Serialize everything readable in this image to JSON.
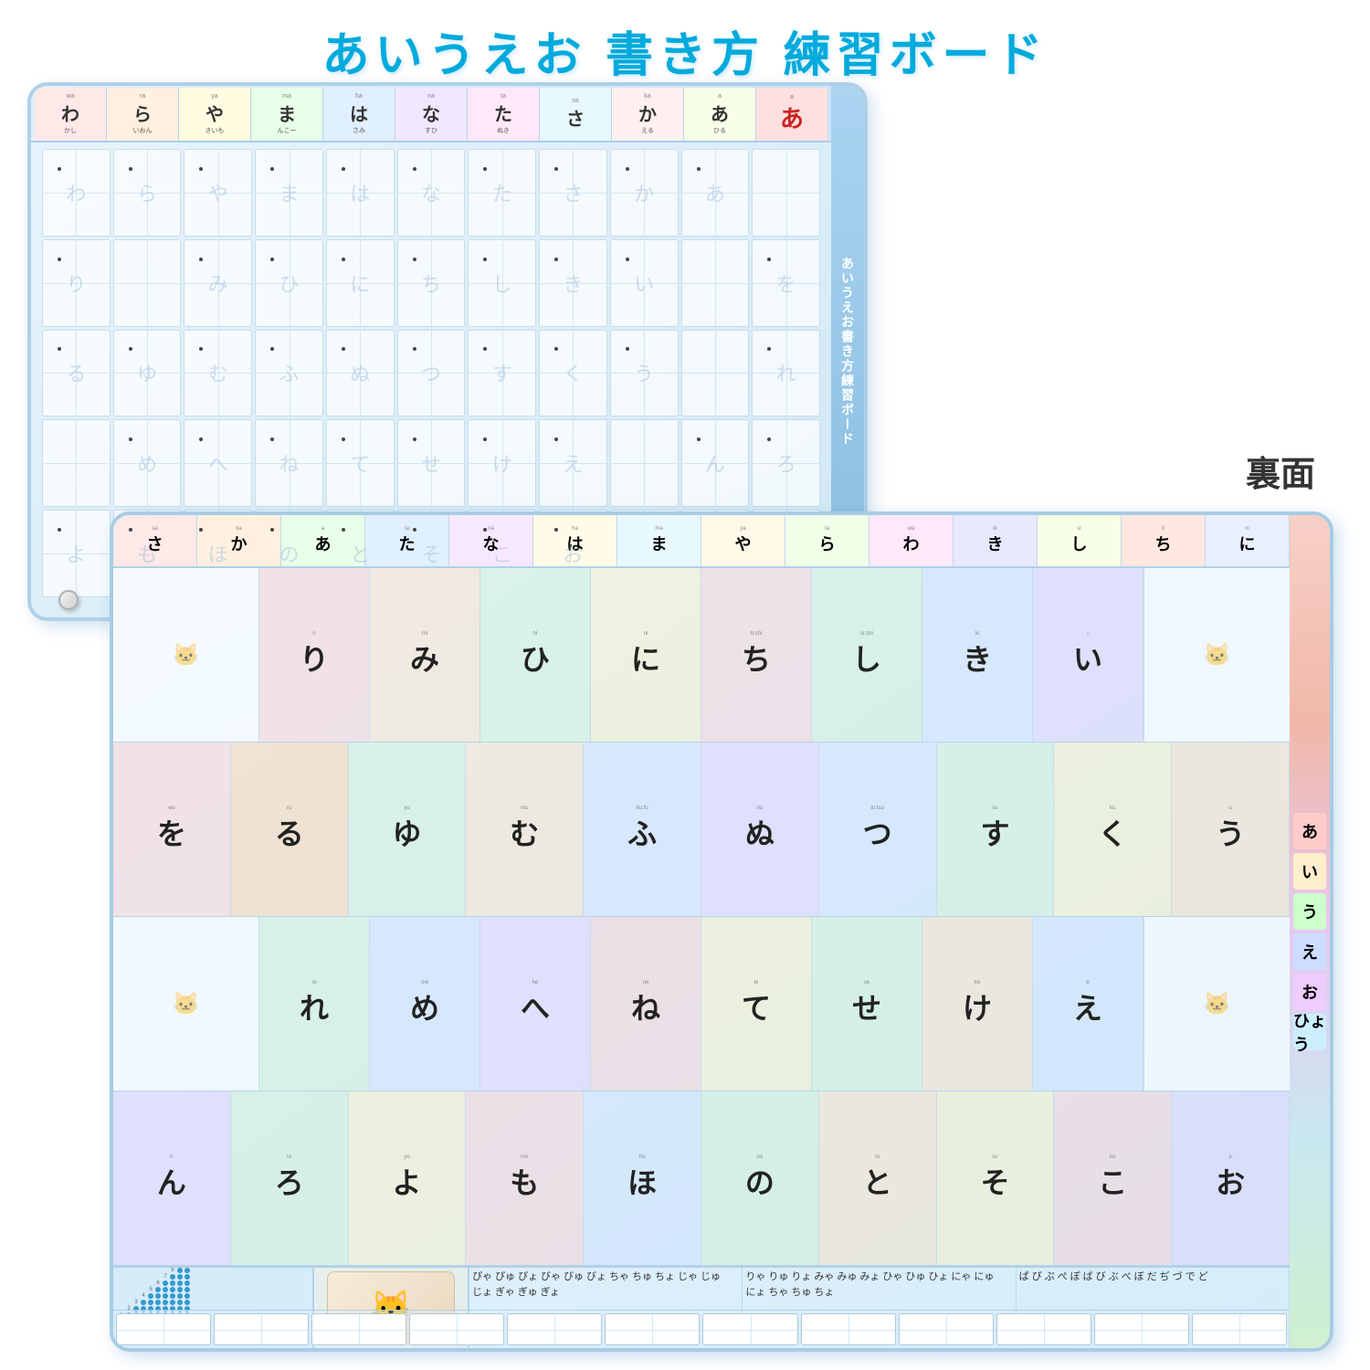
{
  "title": "あいうえお 書き方 練習ボード",
  "ura_label": "裏面",
  "front": {
    "vertical_label": "あいうえお書き方練習ボード",
    "strip": [
      {
        "romaji": "wa",
        "kana": "わ",
        "word": "かし"
      },
      {
        "romaji": "ra",
        "kana": "ら",
        "word": "いおん"
      },
      {
        "romaji": "ya",
        "kana": "や",
        "word": "きいも"
      },
      {
        "romaji": "ma",
        "kana": "ま",
        "word": "んこー"
      },
      {
        "romaji": "ha",
        "kana": "は",
        "word": "さみ"
      },
      {
        "romaji": "na",
        "kana": "な",
        "word": "すひ"
      },
      {
        "romaji": "ta",
        "kana": "た",
        "word": "ぬき"
      },
      {
        "romaji": "sa",
        "kana": "さ",
        "word": ""
      },
      {
        "romaji": "ka",
        "kana": "か",
        "word": "える"
      },
      {
        "romaji": "a",
        "kana": "あ",
        "word": "ひる"
      }
    ],
    "grid_kana": [
      "わ",
      "ら",
      "や",
      "ま",
      "は",
      "な",
      "た",
      "さ",
      "か",
      "あ",
      "",
      "り",
      "",
      "み",
      "ひ",
      "に",
      "ち",
      "し",
      "き",
      "い",
      "",
      "を",
      "る",
      "ゆ",
      "む",
      "ふ",
      "ぬ",
      "つ",
      "す",
      "く",
      "う",
      "",
      "れ",
      "",
      "め",
      "へ",
      "ね",
      "て",
      "せ",
      "け",
      "え",
      "",
      "ん",
      "ろ",
      "よ",
      "も",
      "ほ",
      "の",
      "と",
      "そ",
      "こ",
      "お",
      ""
    ]
  },
  "back": {
    "top_strip": [
      {
        "romaji": "sa",
        "kana": "さ"
      },
      {
        "romaji": "ka",
        "kana": "か"
      },
      {
        "romaji": "a",
        "kana": "あ"
      }
    ],
    "right_labels": [
      "あ",
      "い",
      "う",
      "え",
      "お",
      "ひょう"
    ],
    "rows": [
      {
        "id": "ri-row",
        "cells": [
          {
            "kana": "",
            "type": "blank"
          },
          {
            "kana": "り",
            "romaji": "ri",
            "color": "pink"
          },
          {
            "kana": "",
            "type": "blank"
          },
          {
            "kana": "み",
            "romaji": "mi",
            "color": "peach"
          },
          {
            "kana": "ひ",
            "romaji": "hi",
            "color": "green"
          },
          {
            "kana": "に",
            "romaji": "ni",
            "color": "yellow"
          },
          {
            "kana": "ち",
            "romaji": "ti:chi",
            "color": "pink"
          },
          {
            "kana": "し",
            "romaji": "si:shi",
            "color": "green"
          },
          {
            "kana": "き",
            "romaji": "ki",
            "color": "blue"
          },
          {
            "kana": "い",
            "romaji": "i",
            "color": "purple"
          }
        ]
      },
      {
        "id": "wo-row",
        "cells": [
          {
            "kana": "を",
            "romaji": "wo",
            "color": "pink"
          },
          {
            "kana": "る",
            "romaji": "ru",
            "color": "orange"
          },
          {
            "kana": "ゆ",
            "romaji": "yu",
            "color": "green"
          },
          {
            "kana": "む",
            "romaji": "mu",
            "color": "peach"
          },
          {
            "kana": "ふ",
            "romaji": "hu:fu",
            "color": "blue"
          },
          {
            "kana": "ぬ",
            "romaji": "nu",
            "color": "purple"
          },
          {
            "kana": "つ",
            "romaji": "tu:tsu",
            "color": "blue"
          },
          {
            "kana": "す",
            "romaji": "su",
            "color": "green"
          },
          {
            "kana": "く",
            "romaji": "ku",
            "color": "yellow"
          },
          {
            "kana": "う",
            "romaji": "u",
            "color": "peach"
          }
        ]
      },
      {
        "id": "re-row",
        "cells": [
          {
            "kana": "",
            "type": "blank"
          },
          {
            "kana": "れ",
            "romaji": "re",
            "color": "green"
          },
          {
            "kana": "",
            "type": "blank"
          },
          {
            "kana": "め",
            "romaji": "me",
            "color": "blue"
          },
          {
            "kana": "へ",
            "romaji": "he",
            "color": "purple"
          },
          {
            "kana": "ね",
            "romaji": "ne",
            "color": "pink"
          },
          {
            "kana": "て",
            "romaji": "te",
            "color": "yellow"
          },
          {
            "kana": "せ",
            "romaji": "se",
            "color": "green"
          },
          {
            "kana": "け",
            "romaji": "ke",
            "color": "peach"
          },
          {
            "kana": "え",
            "romaji": "e",
            "color": "blue"
          }
        ]
      },
      {
        "id": "n-row",
        "cells": [
          {
            "kana": "ん",
            "romaji": "n",
            "color": "purple"
          },
          {
            "kana": "ろ",
            "romaji": "ro",
            "color": "green"
          },
          {
            "kana": "よ",
            "romaji": "yo",
            "color": "yellow"
          },
          {
            "kana": "も",
            "romaji": "mo",
            "color": "pink"
          },
          {
            "kana": "ほ",
            "romaji": "ho",
            "color": "blue"
          },
          {
            "kana": "の",
            "romaji": "no",
            "color": "green"
          },
          {
            "kana": "と",
            "romaji": "to",
            "color": "peach"
          },
          {
            "kana": "そ",
            "romaji": "so",
            "color": "yellow"
          },
          {
            "kana": "こ",
            "romaji": "ko",
            "color": "pink"
          },
          {
            "kana": "お",
            "romaji": "o",
            "color": "purple"
          }
        ]
      }
    ],
    "dakuten": {
      "col1": [
        "ぴゃ",
        "ぴゅ",
        "ぴょ",
        "びゃ",
        "びゅ",
        "びょ",
        "ちゃ",
        "ちゅ",
        "ちょ",
        "じゃ",
        "じゅ",
        "じょ",
        "ぎゃ",
        "ぎゅ",
        "ぎょ"
      ],
      "col2": [
        "りゃ",
        "りゅ",
        "りょ",
        "みゃ",
        "みゅ",
        "みょ",
        "ひゃ",
        "ひゅ",
        "ひょ",
        "にゃ",
        "にゅ",
        "にょ",
        "ちゃ",
        "ちゅ",
        "ちょ"
      ],
      "col3": [
        "ぱ",
        "ぴ",
        "ぷ",
        "ぺ",
        "ぽ",
        "ば",
        "び",
        "ぶ",
        "べ",
        "ぼ",
        "だ",
        "ぢ",
        "づ",
        "で",
        "ど"
      ]
    },
    "writing_cells_count": 12
  }
}
